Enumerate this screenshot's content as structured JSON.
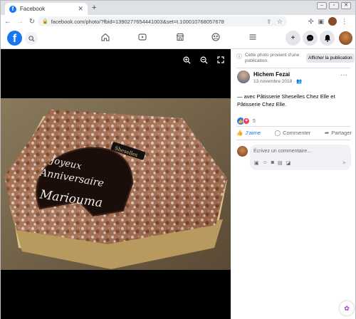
{
  "browser": {
    "tab_title": "Facebook",
    "new_tab": "+",
    "url": "facebook.com/photo/?fbid=1390277654441003&set=t.100010768057678"
  },
  "fb": {
    "logo": "f"
  },
  "panel": {
    "notice_text": "Cette photo provient d’une publication.",
    "notice_button": "Afficher la publication",
    "author": "Hichem Fezai",
    "date": "13 novembre 2018 ·",
    "caption": "— avec Pâtisserie Sheselles Chez Elle et Pâtisserie Chez Elle.",
    "reaction_count": "5",
    "like_label": "J’aime",
    "comment_label": "Commenter",
    "share_label": "Partager",
    "comment_placeholder": "Écrivez un commentaire…"
  },
  "cake": {
    "line1": "Joyeux",
    "line2": "Anniversaire",
    "name": "Mariouma",
    "tag": "Sheselles"
  },
  "colors": {
    "fb_blue": "#1877f2",
    "love_red": "#f33e58"
  }
}
